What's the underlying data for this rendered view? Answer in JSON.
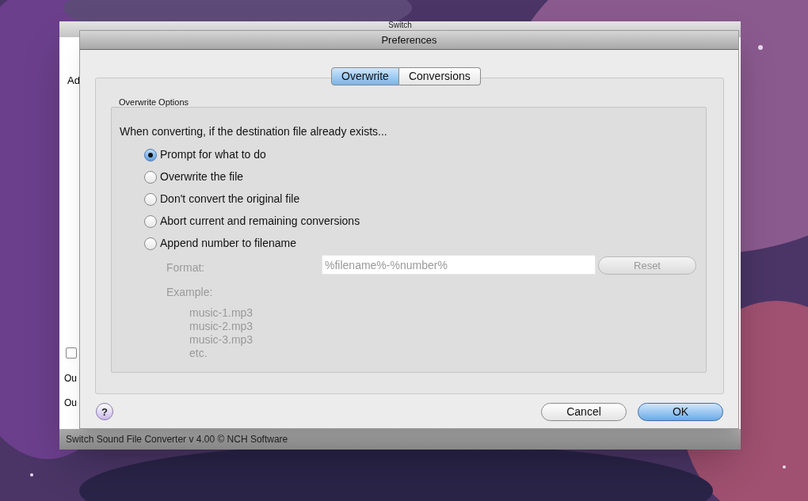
{
  "background_window": {
    "title": "Switch",
    "visible_labels": [
      "Ad",
      "Ou",
      "Ou"
    ],
    "checkbox": {
      "checked": false
    },
    "status_bar": "Switch Sound File Converter v 4.00 © NCH Software"
  },
  "dialog": {
    "title": "Preferences",
    "tabs": [
      {
        "label": "Overwrite",
        "selected": true
      },
      {
        "label": "Conversions",
        "selected": false
      }
    ],
    "group_label": "Overwrite Options",
    "prompt": "When converting, if the destination file already exists...",
    "options": [
      {
        "label": "Prompt for what to do",
        "selected": true
      },
      {
        "label": "Overwrite the file",
        "selected": false
      },
      {
        "label": "Don't convert the original file",
        "selected": false
      },
      {
        "label": "Abort current and remaining conversions",
        "selected": false
      },
      {
        "label": "Append number to filename",
        "selected": false
      }
    ],
    "format": {
      "label": "Format:",
      "value": "%filename%-%number%",
      "disabled": true,
      "reset_button": "Reset"
    },
    "example": {
      "label": "Example:",
      "lines": [
        "music-1.mp3",
        "music-2.mp3",
        "music-3.mp3",
        "etc."
      ]
    },
    "help_button": "?",
    "buttons": [
      {
        "label": "Cancel",
        "default": false
      },
      {
        "label": "OK",
        "default": true
      }
    ]
  }
}
